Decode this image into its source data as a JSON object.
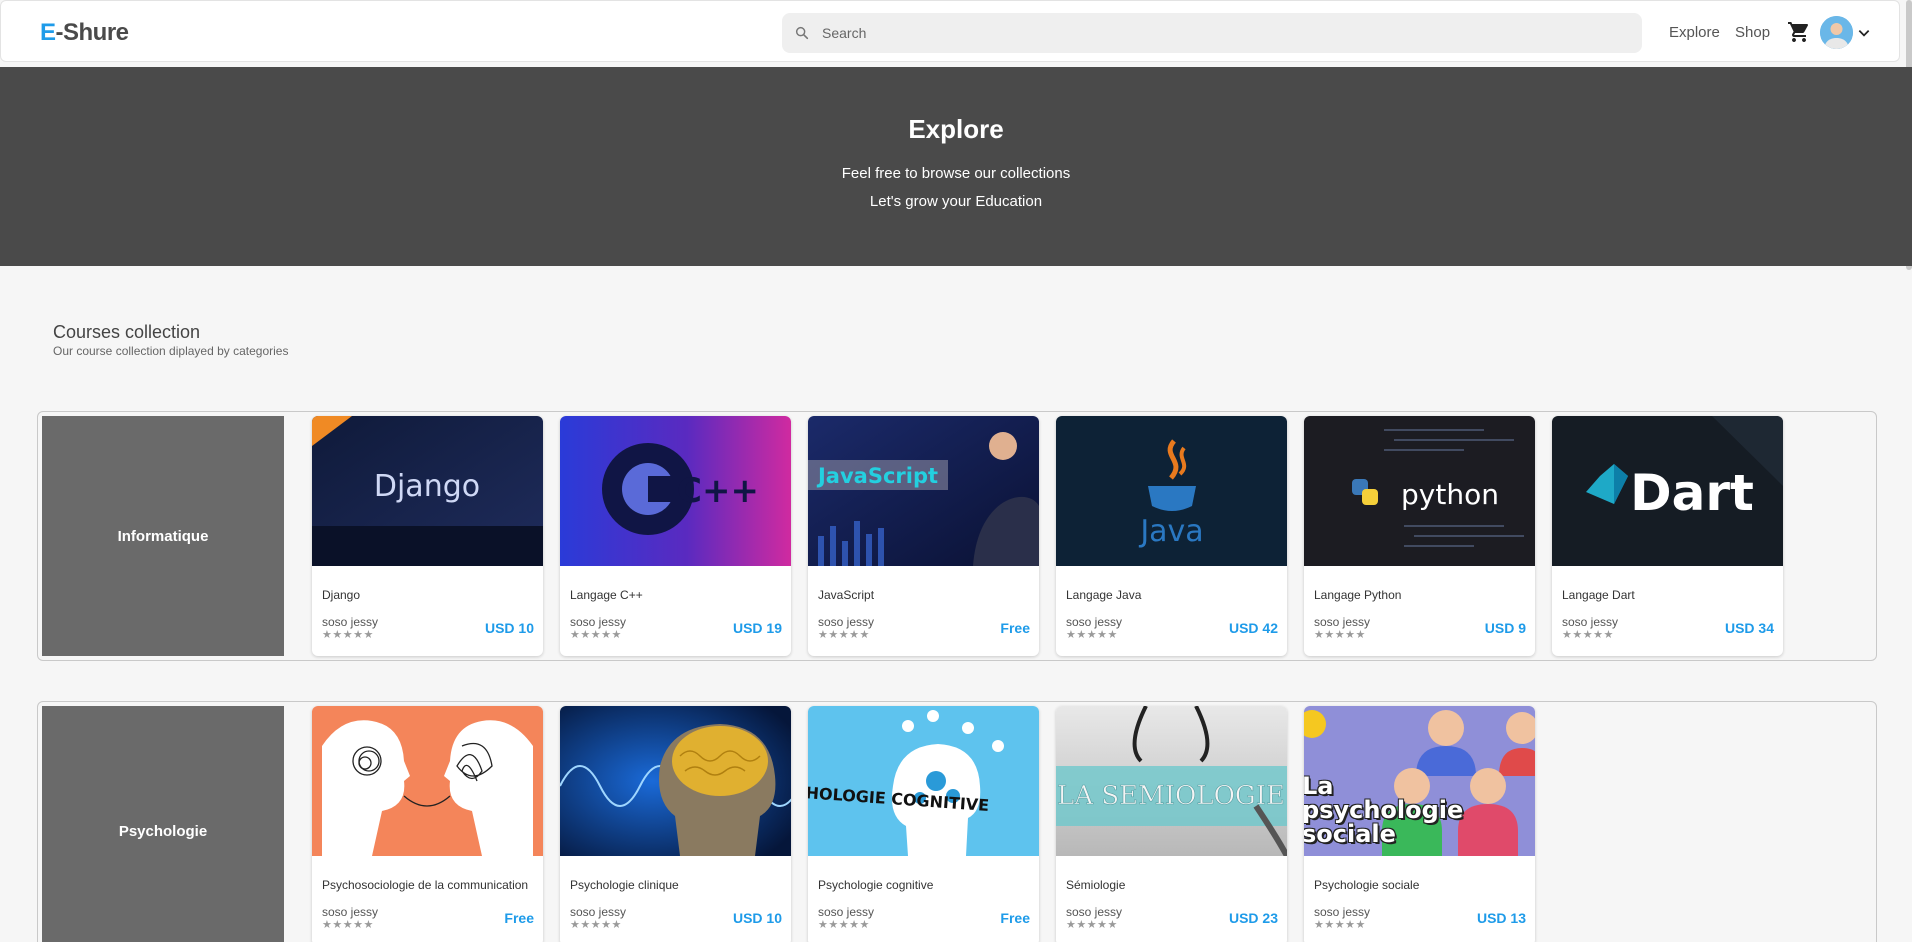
{
  "header": {
    "logo_e": "E",
    "logo_rest": "-Shure",
    "search_placeholder": "Search",
    "nav": {
      "explore": "Explore",
      "shop": "Shop"
    }
  },
  "hero": {
    "title": "Explore",
    "subtitle1": "Feel free to browse our collections",
    "subtitle2": "Let's grow your Education"
  },
  "collection": {
    "title": "Courses collection",
    "subtitle": "Our course collection diplayed by categories"
  },
  "categories": [
    {
      "name": "Informatique",
      "courses": [
        {
          "title": "Django",
          "author": "soso jessy",
          "price": "USD 10",
          "thumb_text": "Django"
        },
        {
          "title": "Langage C++",
          "author": "soso jessy",
          "price": "USD 19",
          "thumb_text": "C++"
        },
        {
          "title": "JavaScript",
          "author": "soso jessy",
          "price": "Free",
          "thumb_text": "JavaScript"
        },
        {
          "title": "Langage Java",
          "author": "soso jessy",
          "price": "USD 42",
          "thumb_text": "Java"
        },
        {
          "title": "Langage Python",
          "author": "soso jessy",
          "price": "USD 9",
          "thumb_text": "python"
        },
        {
          "title": "Langage Dart",
          "author": "soso jessy",
          "price": "USD 34",
          "thumb_text": "Dart"
        }
      ]
    },
    {
      "name": "Psychologie",
      "courses": [
        {
          "title": "Psychosociologie de la communication",
          "author": "soso jessy",
          "price": "Free",
          "thumb_text": ""
        },
        {
          "title": "Psychologie clinique",
          "author": "soso jessy",
          "price": "USD 10",
          "thumb_text": ""
        },
        {
          "title": "Psychologie cognitive",
          "author": "soso jessy",
          "price": "Free",
          "thumb_text": "LA PSYCHOLOGIE COGNITIVE"
        },
        {
          "title": "Sémiologie",
          "author": "soso jessy",
          "price": "USD 23",
          "thumb_text": "LA SEMIOLOGIE"
        },
        {
          "title": "Psychologie sociale",
          "author": "soso jessy",
          "price": "USD 13",
          "thumb_text": "La psychologie sociale"
        }
      ]
    }
  ],
  "rating_stars": "★★★★★",
  "colors": {
    "accent": "#1e9be9",
    "hero_bg": "#4a4a4a",
    "category_bg": "#6a6a6a"
  }
}
